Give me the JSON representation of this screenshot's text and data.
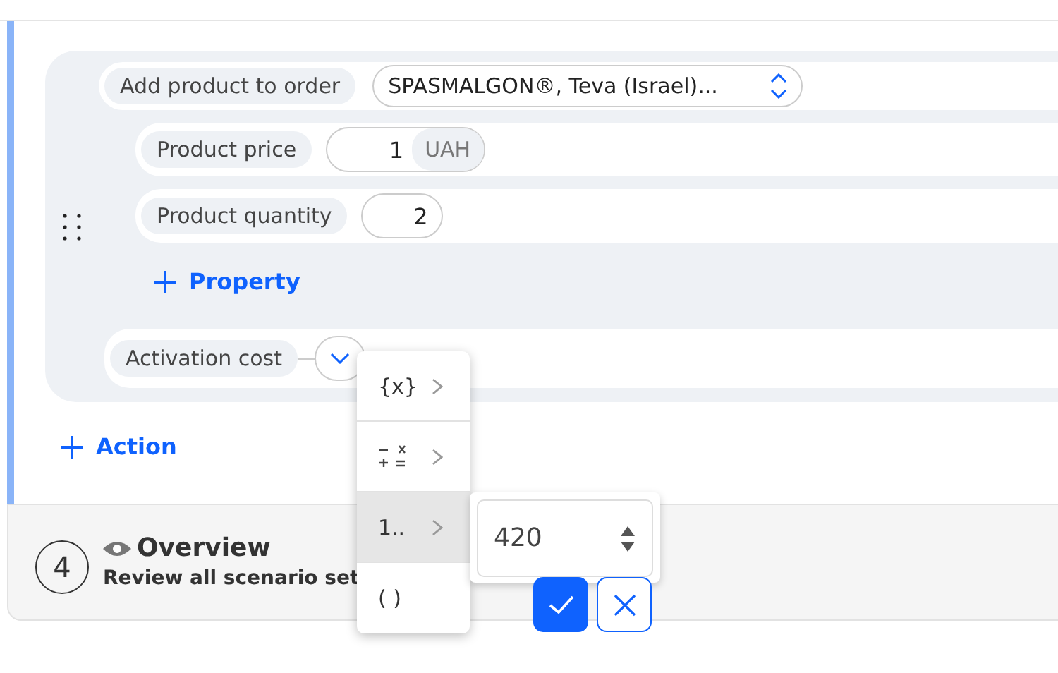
{
  "action_block": {
    "product_row": {
      "label": "Add product to order",
      "select_value": "SPASMALGON®, Teva  (Israel)..."
    },
    "properties": [
      {
        "label": "Product price",
        "value": "1",
        "unit": "UAH"
      },
      {
        "label": "Product quantity",
        "value": "2"
      }
    ],
    "add_property": "Property",
    "activation": {
      "label": "Activation cost",
      "expanded": true
    }
  },
  "add_action": "Action",
  "step": {
    "number": "4",
    "title": "Overview",
    "description": "Review all scenario set"
  },
  "value_menu": {
    "items": [
      {
        "kind": "text",
        "label": "{x}",
        "submenu": true,
        "selected": false
      },
      {
        "kind": "operators",
        "submenu": true,
        "selected": false
      },
      {
        "kind": "text",
        "label": "1..",
        "submenu": true,
        "selected": true
      },
      {
        "kind": "text",
        "label": "( )",
        "submenu": false,
        "selected": false
      }
    ]
  },
  "number_input": {
    "value": "420"
  },
  "buttons": [
    {
      "kind": "confirm"
    },
    {
      "kind": "cancel"
    }
  ]
}
